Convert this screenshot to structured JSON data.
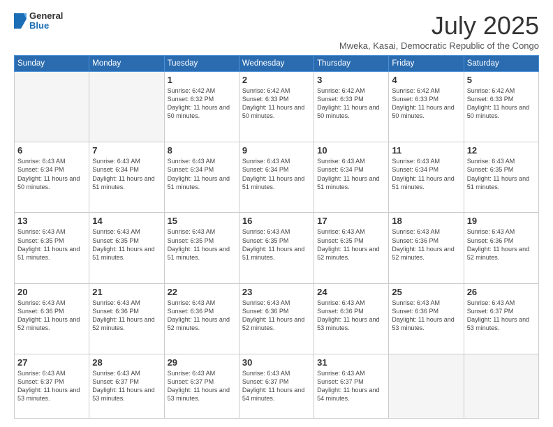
{
  "header": {
    "logo_general": "General",
    "logo_blue": "Blue",
    "month_year": "July 2025",
    "location": "Mweka, Kasai, Democratic Republic of the Congo"
  },
  "weekdays": [
    "Sunday",
    "Monday",
    "Tuesday",
    "Wednesday",
    "Thursday",
    "Friday",
    "Saturday"
  ],
  "weeks": [
    [
      {
        "day": "",
        "empty": true
      },
      {
        "day": "",
        "empty": true
      },
      {
        "day": "1",
        "sunrise": "6:42 AM",
        "sunset": "6:32 PM",
        "daylight": "11 hours and 50 minutes."
      },
      {
        "day": "2",
        "sunrise": "6:42 AM",
        "sunset": "6:33 PM",
        "daylight": "11 hours and 50 minutes."
      },
      {
        "day": "3",
        "sunrise": "6:42 AM",
        "sunset": "6:33 PM",
        "daylight": "11 hours and 50 minutes."
      },
      {
        "day": "4",
        "sunrise": "6:42 AM",
        "sunset": "6:33 PM",
        "daylight": "11 hours and 50 minutes."
      },
      {
        "day": "5",
        "sunrise": "6:42 AM",
        "sunset": "6:33 PM",
        "daylight": "11 hours and 50 minutes."
      }
    ],
    [
      {
        "day": "6",
        "sunrise": "6:43 AM",
        "sunset": "6:34 PM",
        "daylight": "11 hours and 50 minutes."
      },
      {
        "day": "7",
        "sunrise": "6:43 AM",
        "sunset": "6:34 PM",
        "daylight": "11 hours and 51 minutes."
      },
      {
        "day": "8",
        "sunrise": "6:43 AM",
        "sunset": "6:34 PM",
        "daylight": "11 hours and 51 minutes."
      },
      {
        "day": "9",
        "sunrise": "6:43 AM",
        "sunset": "6:34 PM",
        "daylight": "11 hours and 51 minutes."
      },
      {
        "day": "10",
        "sunrise": "6:43 AM",
        "sunset": "6:34 PM",
        "daylight": "11 hours and 51 minutes."
      },
      {
        "day": "11",
        "sunrise": "6:43 AM",
        "sunset": "6:34 PM",
        "daylight": "11 hours and 51 minutes."
      },
      {
        "day": "12",
        "sunrise": "6:43 AM",
        "sunset": "6:35 PM",
        "daylight": "11 hours and 51 minutes."
      }
    ],
    [
      {
        "day": "13",
        "sunrise": "6:43 AM",
        "sunset": "6:35 PM",
        "daylight": "11 hours and 51 minutes."
      },
      {
        "day": "14",
        "sunrise": "6:43 AM",
        "sunset": "6:35 PM",
        "daylight": "11 hours and 51 minutes."
      },
      {
        "day": "15",
        "sunrise": "6:43 AM",
        "sunset": "6:35 PM",
        "daylight": "11 hours and 51 minutes."
      },
      {
        "day": "16",
        "sunrise": "6:43 AM",
        "sunset": "6:35 PM",
        "daylight": "11 hours and 51 minutes."
      },
      {
        "day": "17",
        "sunrise": "6:43 AM",
        "sunset": "6:35 PM",
        "daylight": "11 hours and 52 minutes."
      },
      {
        "day": "18",
        "sunrise": "6:43 AM",
        "sunset": "6:36 PM",
        "daylight": "11 hours and 52 minutes."
      },
      {
        "day": "19",
        "sunrise": "6:43 AM",
        "sunset": "6:36 PM",
        "daylight": "11 hours and 52 minutes."
      }
    ],
    [
      {
        "day": "20",
        "sunrise": "6:43 AM",
        "sunset": "6:36 PM",
        "daylight": "11 hours and 52 minutes."
      },
      {
        "day": "21",
        "sunrise": "6:43 AM",
        "sunset": "6:36 PM",
        "daylight": "11 hours and 52 minutes."
      },
      {
        "day": "22",
        "sunrise": "6:43 AM",
        "sunset": "6:36 PM",
        "daylight": "11 hours and 52 minutes."
      },
      {
        "day": "23",
        "sunrise": "6:43 AM",
        "sunset": "6:36 PM",
        "daylight": "11 hours and 52 minutes."
      },
      {
        "day": "24",
        "sunrise": "6:43 AM",
        "sunset": "6:36 PM",
        "daylight": "11 hours and 53 minutes."
      },
      {
        "day": "25",
        "sunrise": "6:43 AM",
        "sunset": "6:36 PM",
        "daylight": "11 hours and 53 minutes."
      },
      {
        "day": "26",
        "sunrise": "6:43 AM",
        "sunset": "6:37 PM",
        "daylight": "11 hours and 53 minutes."
      }
    ],
    [
      {
        "day": "27",
        "sunrise": "6:43 AM",
        "sunset": "6:37 PM",
        "daylight": "11 hours and 53 minutes."
      },
      {
        "day": "28",
        "sunrise": "6:43 AM",
        "sunset": "6:37 PM",
        "daylight": "11 hours and 53 minutes."
      },
      {
        "day": "29",
        "sunrise": "6:43 AM",
        "sunset": "6:37 PM",
        "daylight": "11 hours and 53 minutes."
      },
      {
        "day": "30",
        "sunrise": "6:43 AM",
        "sunset": "6:37 PM",
        "daylight": "11 hours and 54 minutes."
      },
      {
        "day": "31",
        "sunrise": "6:43 AM",
        "sunset": "6:37 PM",
        "daylight": "11 hours and 54 minutes."
      },
      {
        "day": "",
        "empty": true
      },
      {
        "day": "",
        "empty": true
      }
    ]
  ],
  "labels": {
    "sunrise_prefix": "Sunrise: ",
    "sunset_prefix": "Sunset: ",
    "daylight_prefix": "Daylight: "
  }
}
